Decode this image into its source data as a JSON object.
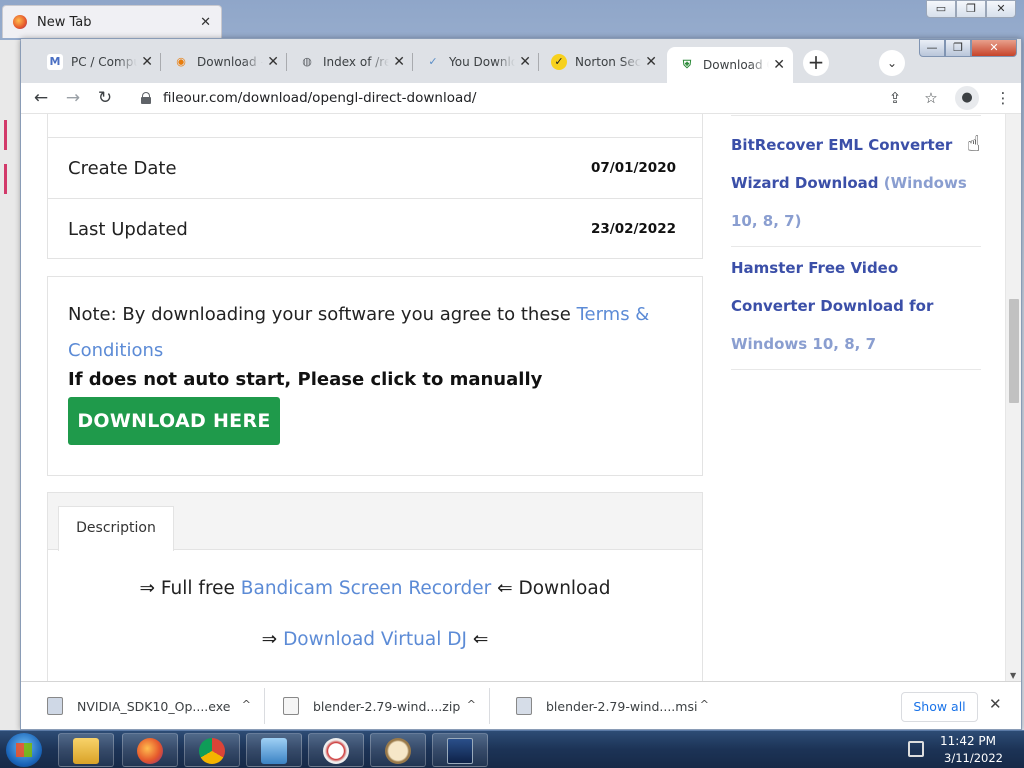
{
  "background_window": {
    "tab_title": "New Tab",
    "tab_close": "✕",
    "controls": [
      "▭",
      "❐",
      "✕"
    ]
  },
  "chrome": {
    "tabs": [
      {
        "title": "PC / Computer",
        "icon": "gmail-icon",
        "close": "✕"
      },
      {
        "title": "Download - B",
        "icon": "blender-icon",
        "close": "✕"
      },
      {
        "title": "Index of /re",
        "icon": "globe-icon",
        "close": "✕"
      },
      {
        "title": "You Downloa",
        "icon": "check-icon",
        "close": "✕"
      },
      {
        "title": "Norton Secur",
        "icon": "norton-icon",
        "close": "✕"
      },
      {
        "title": "Download OpenGL",
        "icon": "shield-icon",
        "close": "✕"
      }
    ],
    "new_tab": "+",
    "tab_search": "⌄",
    "window_controls": {
      "min": "—",
      "max": "❐",
      "close": "✕"
    },
    "nav": {
      "back": "←",
      "forward": "→",
      "reload": "↻"
    },
    "url": "fileour.com/download/opengl-direct-download/",
    "toolbar_icons": {
      "share": "⇪",
      "bookmark": "☆",
      "profile": "●",
      "menu": "⋮"
    }
  },
  "page": {
    "info_rows": [
      {
        "key": "Create Date",
        "value": "07/01/2020"
      },
      {
        "key": "Last Updated",
        "value": "23/02/2022"
      }
    ],
    "note": {
      "text": "Note: By downloading your software you agree to these ",
      "link": "Terms & Conditions",
      "manual": "If does not auto start, Please click to manually",
      "button": "DOWNLOAD HERE"
    },
    "description": {
      "tab": "Description",
      "line1_prefix": "⇒ Full free ",
      "line1_link": "Bandicam Screen Recorder",
      "line1_suffix": " ⇐ Download",
      "line2_prefix": "⇒ ",
      "line2_link": "Download Virtual DJ",
      "line2_suffix": " ⇐"
    },
    "sidebar": [
      {
        "main": "BitRecover EML Converter Wizard Download",
        "extra": " (Windows 10, 8, 7)"
      },
      {
        "main": "Hamster Free Video Converter Download for",
        "extra": " Windows 10, 8, 7"
      }
    ]
  },
  "downloads": {
    "items": [
      {
        "name": "NVIDIA_SDK10_Op....exe"
      },
      {
        "name": "blender-2.79-wind....zip"
      },
      {
        "name": "blender-2.79-wind....msi"
      }
    ],
    "show_all": "Show all",
    "close": "✕",
    "chevron": "^"
  },
  "taskbar": {
    "time": "11:42 PM",
    "date": "3/11/2022"
  },
  "colors": {
    "download_button": "#1f9a4b",
    "link": "#5c8bd6",
    "sidebar_link": "#3b4fa8"
  }
}
